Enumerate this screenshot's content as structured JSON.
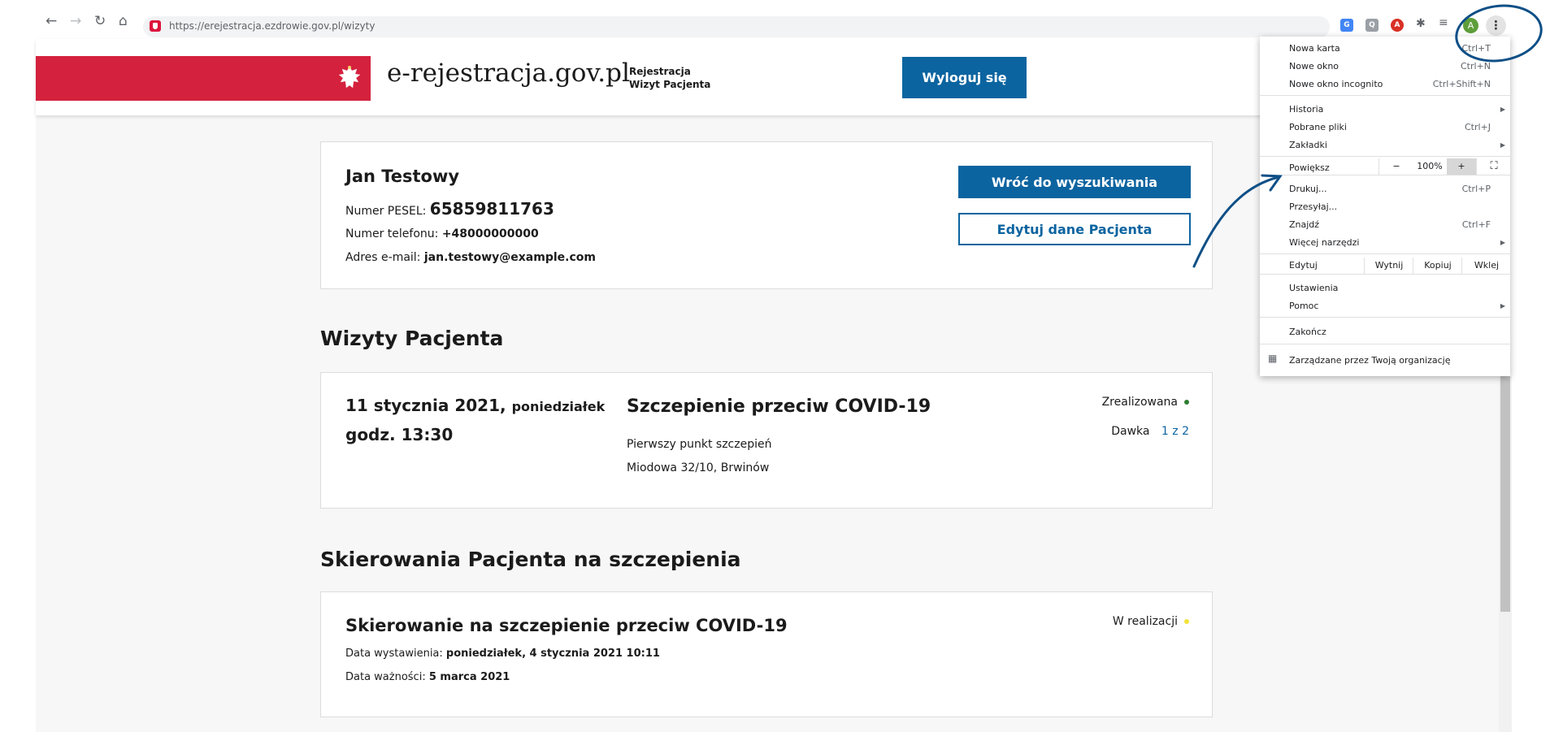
{
  "browser": {
    "url": "https://erejestracja.ezdrowie.gov.pl/wizyty",
    "avatar_letter": "A",
    "kebab": "⋮"
  },
  "header": {
    "site_title": "e-rejestracja.gov.pl",
    "subtitle_line1": "Rejestracja",
    "subtitle_line2": "Wizyt Pacjenta",
    "logout_label": "Wyloguj się"
  },
  "patient": {
    "name": "Jan Testowy",
    "pesel_label": "Numer PESEL:",
    "pesel_value": "65859811763",
    "phone_label": "Numer telefonu:",
    "phone_value": "+48000000000",
    "email_label": "Adres e-mail:",
    "email_value": "jan.testowy@example.com",
    "back_button": "Wróć do wyszukiwania",
    "edit_button": "Edytuj dane Pacjenta"
  },
  "visits_section": {
    "title": "Wizyty Pacjenta",
    "visit": {
      "date": "11 stycznia 2021,",
      "weekday": "poniedziałek",
      "time": "godz. 13:30",
      "title": "Szczepienie przeciw COVID-19",
      "place": "Pierwszy punkt szczepień",
      "address": "Miodowa 32/10, Brwinów",
      "status": "Zrealizowana",
      "status_color": "#2e7d32",
      "dose_label": "Dawka",
      "dose_value": "1 z 2"
    }
  },
  "referrals_section": {
    "title": "Skierowania Pacjenta na szczepienia",
    "referral": {
      "title": "Skierowanie na szczepienie przeciw COVID-19",
      "issued_label": "Data wystawienia:",
      "issued_value": "poniedziałek, 4 stycznia 2021 10:11",
      "valid_label": "Data ważności:",
      "valid_value": "5 marca 2021",
      "status": "W realizacji",
      "status_color": "#f2e33a"
    }
  },
  "menu": {
    "new_tab": "Nowa karta",
    "new_tab_sc": "Ctrl+T",
    "new_window": "Nowe okno",
    "new_window_sc": "Ctrl+N",
    "incognito": "Nowe okno incognito",
    "incognito_sc": "Ctrl+Shift+N",
    "history": "Historia",
    "downloads": "Pobrane pliki",
    "downloads_sc": "Ctrl+J",
    "bookmarks": "Zakładki",
    "zoom": "Powiększ",
    "zoom_minus": "−",
    "zoom_value": "100%",
    "zoom_plus": "+",
    "print": "Drukuj...",
    "print_sc": "Ctrl+P",
    "cast": "Przesyłaj...",
    "find": "Znajdź",
    "find_sc": "Ctrl+F",
    "more_tools": "Więcej narzędzi",
    "edit": "Edytuj",
    "cut": "Wytnij",
    "copy": "Kopiuj",
    "paste": "Wklej",
    "settings": "Ustawienia",
    "help": "Pomoc",
    "exit": "Zakończ",
    "managed": "Zarządzane przez Twoją organizację"
  },
  "colors": {
    "brand_blue": "#0b64a0",
    "brand_red": "#d4213d",
    "annotation_blue": "#0e4f86"
  }
}
